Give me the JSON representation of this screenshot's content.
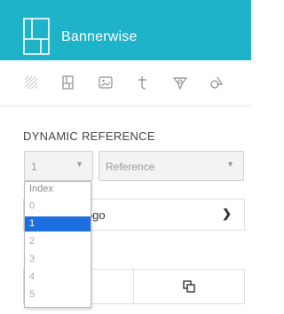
{
  "header": {
    "app_title": "Bannerwise",
    "background": "#1fb3c9"
  },
  "toolbar": {
    "icons": [
      "texture-icon",
      "layout-icon",
      "image-icon",
      "text-icon",
      "shape-icon",
      "group-icon"
    ]
  },
  "dynamic_reference": {
    "title": "DYNAMIC REFERENCE",
    "index_select": {
      "value": "1"
    },
    "reference_select": {
      "placeholder": "Reference"
    },
    "dropdown": {
      "options": [
        "Index",
        "0",
        "1",
        "2",
        "3",
        "4",
        "5"
      ],
      "selected": "1",
      "selected_color": "#1e6fe0"
    }
  },
  "logo_row": {
    "label": "logo"
  }
}
